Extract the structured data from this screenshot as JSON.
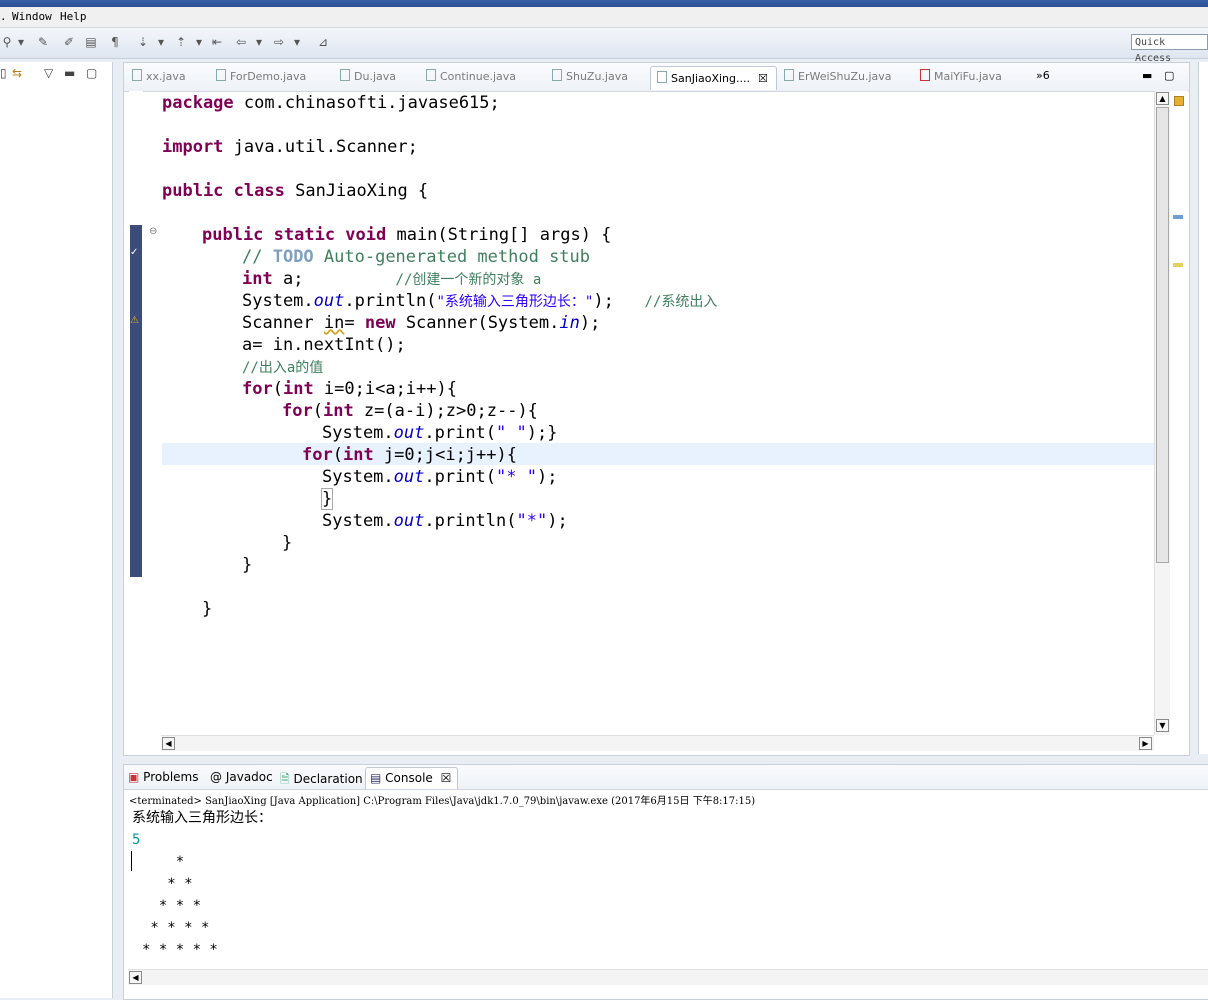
{
  "menu": {
    "window": "Window",
    "help": "Help"
  },
  "toolbar": {
    "quick_access_placeholder": "Quick Access"
  },
  "editor": {
    "tabs": [
      {
        "label": "xx.java"
      },
      {
        "label": "ForDemo.java"
      },
      {
        "label": "Du.java"
      },
      {
        "label": "Continue.java"
      },
      {
        "label": "ShuZu.java"
      },
      {
        "label": "SanJiaoXing...."
      },
      {
        "label": "ErWeiShuZu.java"
      },
      {
        "label": "MaiYiFu.java"
      }
    ],
    "overflow_count": "»6",
    "code": {
      "l1_kw": "package",
      "l1_rest": " com.chinasofti.javase615;",
      "l3_kw": "import",
      "l3_rest": " java.util.Scanner;",
      "l5_kw1": "public",
      "l5_kw2": "class",
      "l5_rest": " SanJiaoXing {",
      "l7_kw": "public static void",
      "l7_rest": " main(String[] args) {",
      "l8_c1": "// ",
      "l8_todo": "TODO",
      "l8_c2": " Auto-generated method stub",
      "l9_kw": "int",
      "l9_rest": " a;         ",
      "l9_cm": "//创建一个新的对象 a",
      "l10_a": "System.",
      "l10_f": "out",
      "l10_b": ".println(",
      "l10_s": "\"系统输入三角形边长：\"",
      "l10_c": ");   ",
      "l10_cm": "//系统出入",
      "l11_a": "Scanner ",
      "l11_b": "in",
      "l11_c": "= ",
      "l11_kw": "new",
      "l11_d": " Scanner(System.",
      "l11_f": "in",
      "l11_e": ");",
      "l12": "a= in.nextInt();",
      "l13_cm": "//出入a的值",
      "l14_kw1": "for",
      "l14_a": "(",
      "l14_kw2": "int",
      "l14_b": " i=0;i<a;i++){",
      "l15_kw1": "for",
      "l15_a": "(",
      "l15_kw2": "int",
      "l15_b": " z=(a-i);z>0;z--){",
      "l16_a": "System.",
      "l16_f": "out",
      "l16_b": ".print(",
      "l16_s": "\" \"",
      "l16_c": ");}",
      "l17_kw1": "for",
      "l17_a": "(",
      "l17_kw2": "int",
      "l17_b": " j=0;j<i;j++){",
      "l18_a": "System.",
      "l18_f": "out",
      "l18_b": ".print(",
      "l18_s": "\"* \"",
      "l18_c": ");",
      "l19": "}",
      "l20_a": "System.",
      "l20_f": "out",
      "l20_b": ".println(",
      "l20_s": "\"*\"",
      "l20_c": ");",
      "l21": "}",
      "l22": "}",
      "l24": "}"
    }
  },
  "console": {
    "tabs": {
      "problems": "Problems",
      "javadoc": "Javadoc",
      "declaration": "Declaration",
      "console": "Console"
    },
    "status": "<terminated> SanJiaoXing [Java Application] C:\\Program Files\\Java\\jdk1.7.0_79\\bin\\javaw.exe (2017年6月15日 下午8:17:15)",
    "prompt": "系统输入三角形边长：",
    "input": "5",
    "output": [
      "    *",
      "   * *",
      "  * * *",
      " * * * *",
      "* * * * *"
    ]
  },
  "colors": {
    "keyword": "#7f0055",
    "comment": "#3f7f5f",
    "string": "#2a00ff",
    "field": "#0000c0",
    "console_input": "#009a9a"
  }
}
